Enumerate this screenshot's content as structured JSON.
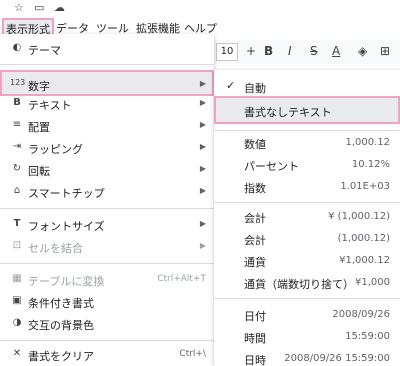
{
  "menubar": {
    "items": [
      {
        "label": "表示形式"
      },
      {
        "label": "データ"
      },
      {
        "label": "ツール"
      },
      {
        "label": "拡張機能"
      },
      {
        "label": "ヘルプ"
      }
    ]
  },
  "toolbar": {
    "font_size": "10",
    "plus": "+",
    "bold": "B",
    "italic": "I",
    "strike": "S",
    "text_color": "A"
  },
  "format_menu": {
    "items": [
      {
        "label": "テーマ"
      },
      {
        "label": "数字"
      },
      {
        "label": "テキスト"
      },
      {
        "label": "配置"
      },
      {
        "label": "ラッピング"
      },
      {
        "label": "回転"
      },
      {
        "label": "スマートチップ"
      },
      {
        "label": "フォントサイズ"
      },
      {
        "label": "セルを結合"
      },
      {
        "label": "テーブルに変換",
        "shortcut": "Ctrl+Alt+T"
      },
      {
        "label": "条件付き書式"
      },
      {
        "label": "交互の背景色"
      },
      {
        "label": "書式をクリア",
        "shortcut": "Ctrl+\\"
      }
    ]
  },
  "number_submenu": {
    "items": [
      {
        "label": "自動",
        "value": ""
      },
      {
        "label": "書式なしテキスト",
        "value": ""
      },
      {
        "label": "数値",
        "value": "1,000.12"
      },
      {
        "label": "パーセント",
        "value": "10.12%"
      },
      {
        "label": "指数",
        "value": "1.01E+03"
      },
      {
        "label": "会計",
        "value": "¥ (1,000.12)"
      },
      {
        "label": "会計",
        "value": "(1,000.12)"
      },
      {
        "label": "通貨",
        "value": "¥1,000.12"
      },
      {
        "label": "通貨（端数切り捨て）",
        "value": "¥1,000"
      },
      {
        "label": "日付",
        "value": "2008/09/26"
      },
      {
        "label": "時間",
        "value": "15:59:00"
      },
      {
        "label": "日時",
        "value": "2008/09/26 15:59:00"
      }
    ]
  },
  "colors": {
    "highlight_border": "#f2a0c4",
    "highlight_bg": "#e8eaed"
  }
}
